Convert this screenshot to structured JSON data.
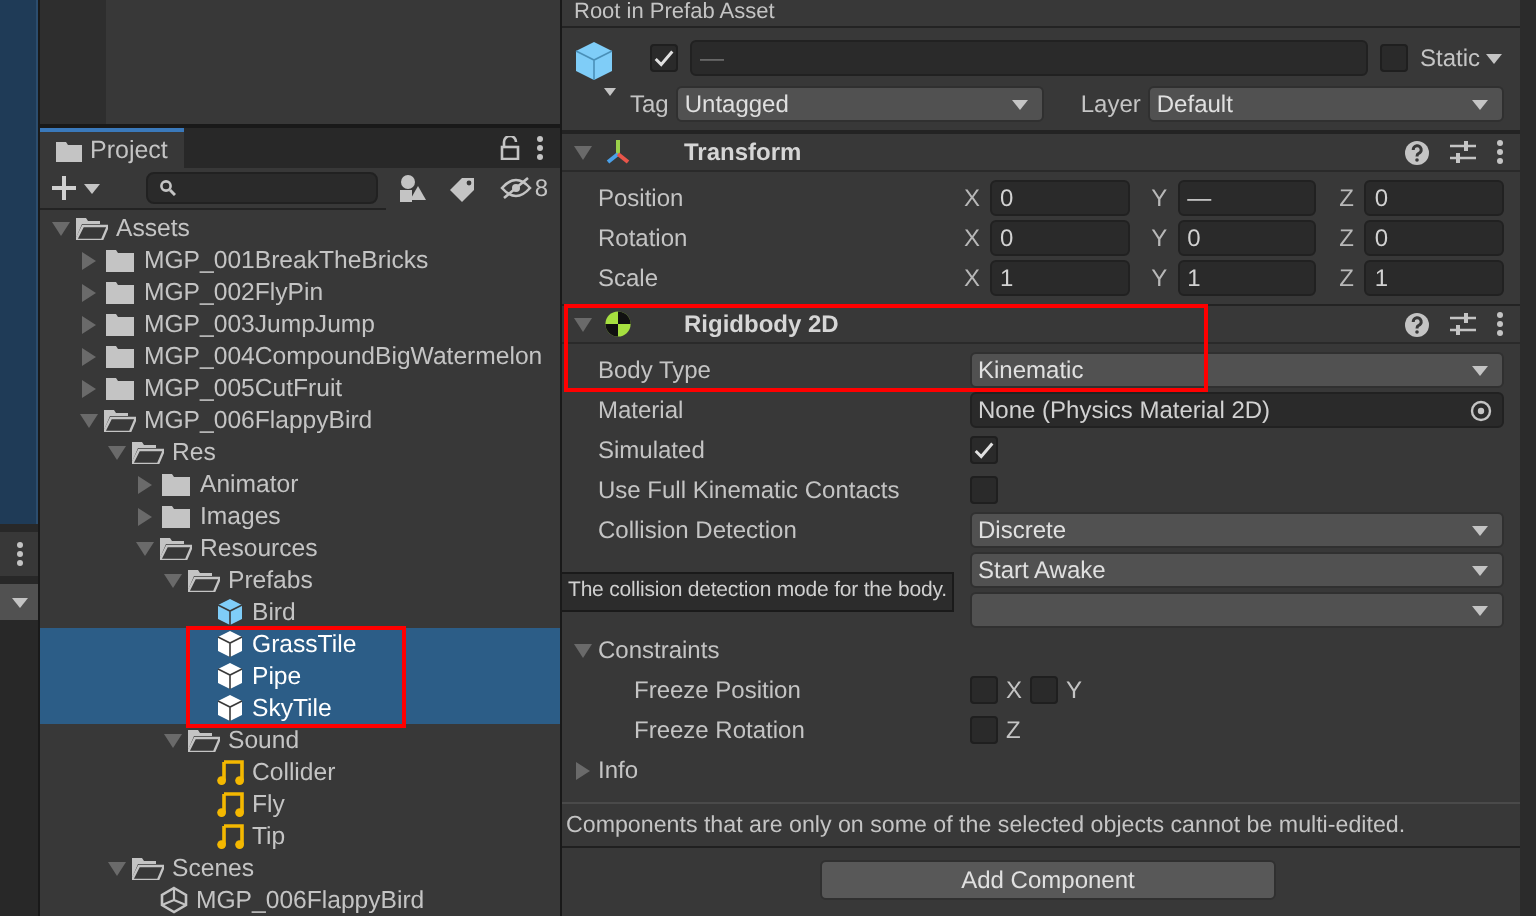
{
  "project": {
    "tab": "Project",
    "hidden_count": "8",
    "tree": [
      {
        "label": "Assets",
        "kind": "folder",
        "expanded": true,
        "selected": false,
        "children": [
          {
            "label": "MGP_001BreakTheBricks",
            "kind": "folder",
            "expanded": false,
            "selected": false
          },
          {
            "label": "MGP_002FlyPin",
            "kind": "folder",
            "expanded": false,
            "selected": false
          },
          {
            "label": "MGP_003JumpJump",
            "kind": "folder",
            "expanded": false,
            "selected": false
          },
          {
            "label": "MGP_004CompoundBigWatermelon",
            "kind": "folder",
            "expanded": false,
            "selected": false
          },
          {
            "label": "MGP_005CutFruit",
            "kind": "folder",
            "expanded": false,
            "selected": false
          },
          {
            "label": "MGP_006FlappyBird",
            "kind": "folder",
            "expanded": true,
            "selected": false,
            "children": [
              {
                "label": "Res",
                "kind": "folder",
                "expanded": true,
                "selected": false,
                "children": [
                  {
                    "label": "Animator",
                    "kind": "folder",
                    "expanded": false,
                    "selected": false
                  },
                  {
                    "label": "Images",
                    "kind": "folder",
                    "expanded": false,
                    "selected": false
                  },
                  {
                    "label": "Resources",
                    "kind": "folder",
                    "expanded": true,
                    "selected": false,
                    "children": [
                      {
                        "label": "Prefabs",
                        "kind": "folder",
                        "expanded": true,
                        "selected": false,
                        "children": [
                          {
                            "label": "Bird",
                            "kind": "prefab",
                            "selected": false
                          },
                          {
                            "label": "GrassTile",
                            "kind": "prefab",
                            "selected": true,
                            "outlined": true
                          },
                          {
                            "label": "Pipe",
                            "kind": "prefab",
                            "selected": true,
                            "outlined": true
                          },
                          {
                            "label": "SkyTile",
                            "kind": "prefab",
                            "selected": true,
                            "outlined": true
                          }
                        ]
                      },
                      {
                        "label": "Sound",
                        "kind": "folder",
                        "expanded": true,
                        "selected": false,
                        "children": [
                          {
                            "label": "Collider",
                            "kind": "audio",
                            "selected": false
                          },
                          {
                            "label": "Fly",
                            "kind": "audio",
                            "selected": false
                          },
                          {
                            "label": "Tip",
                            "kind": "audio",
                            "selected": false
                          }
                        ]
                      }
                    ]
                  }
                ]
              },
              {
                "label": "Scenes",
                "kind": "folder",
                "expanded": true,
                "selected": false,
                "children": [
                  {
                    "label": "MGP_006FlappyBird",
                    "kind": "scene",
                    "selected": false
                  }
                ]
              }
            ]
          }
        ]
      }
    ]
  },
  "inspector": {
    "header": "Root in Prefab Asset",
    "active": true,
    "name": "—",
    "static": {
      "label": "Static",
      "checked": false
    },
    "tag": {
      "label": "Tag",
      "value": "Untagged"
    },
    "layer": {
      "label": "Layer",
      "value": "Default"
    },
    "components": [
      {
        "kind": "transform",
        "title": "Transform",
        "expanded": true,
        "properties": [
          {
            "kind": "vector3",
            "label": "Position",
            "fields": [
              {
                "axis": "X",
                "value": "0"
              },
              {
                "axis": "Y",
                "value": "—"
              },
              {
                "axis": "Z",
                "value": "0"
              }
            ]
          },
          {
            "kind": "vector3",
            "label": "Rotation",
            "fields": [
              {
                "axis": "X",
                "value": "0"
              },
              {
                "axis": "Y",
                "value": "0"
              },
              {
                "axis": "Z",
                "value": "0"
              }
            ]
          },
          {
            "kind": "vector3",
            "label": "Scale",
            "fields": [
              {
                "axis": "X",
                "value": "1"
              },
              {
                "axis": "Y",
                "value": "1"
              },
              {
                "axis": "Z",
                "value": "1"
              }
            ]
          }
        ]
      },
      {
        "kind": "rigidbody2d",
        "title": "Rigidbody 2D",
        "expanded": true,
        "outlined": true,
        "properties": [
          {
            "kind": "dropdown",
            "label": "Body Type",
            "value": "Kinematic"
          },
          {
            "kind": "object",
            "label": "Material",
            "value": "None (Physics Material 2D)"
          },
          {
            "kind": "checkbox",
            "label": "Simulated",
            "checked": true
          },
          {
            "kind": "checkbox",
            "label": "Use Full Kinematic Contacts",
            "checked": false
          },
          {
            "kind": "dropdown",
            "label": "Collision Detection",
            "value": "Discrete"
          },
          {
            "kind": "dropdown",
            "value": "Start Awake",
            "tooltip": "The collision detection mode for the body."
          },
          {
            "kind": "dropdown"
          },
          {
            "kind": "foldout",
            "label": "Constraints",
            "expanded": true,
            "children": [
              {
                "kind": "toggles",
                "label": "Freeze Position",
                "toggles": [
                  {
                    "axis": "X",
                    "checked": false
                  },
                  {
                    "axis": "Y",
                    "checked": false
                  }
                ]
              },
              {
                "kind": "toggles",
                "label": "Freeze Rotation",
                "toggles": [
                  {
                    "axis": "Z",
                    "checked": false
                  }
                ]
              }
            ]
          },
          {
            "kind": "foldout",
            "label": "Info",
            "expanded": false
          }
        ]
      }
    ],
    "message": "Components that are only on some of the selected objects cannot be multi-edited.",
    "add_button": "Add Component"
  }
}
